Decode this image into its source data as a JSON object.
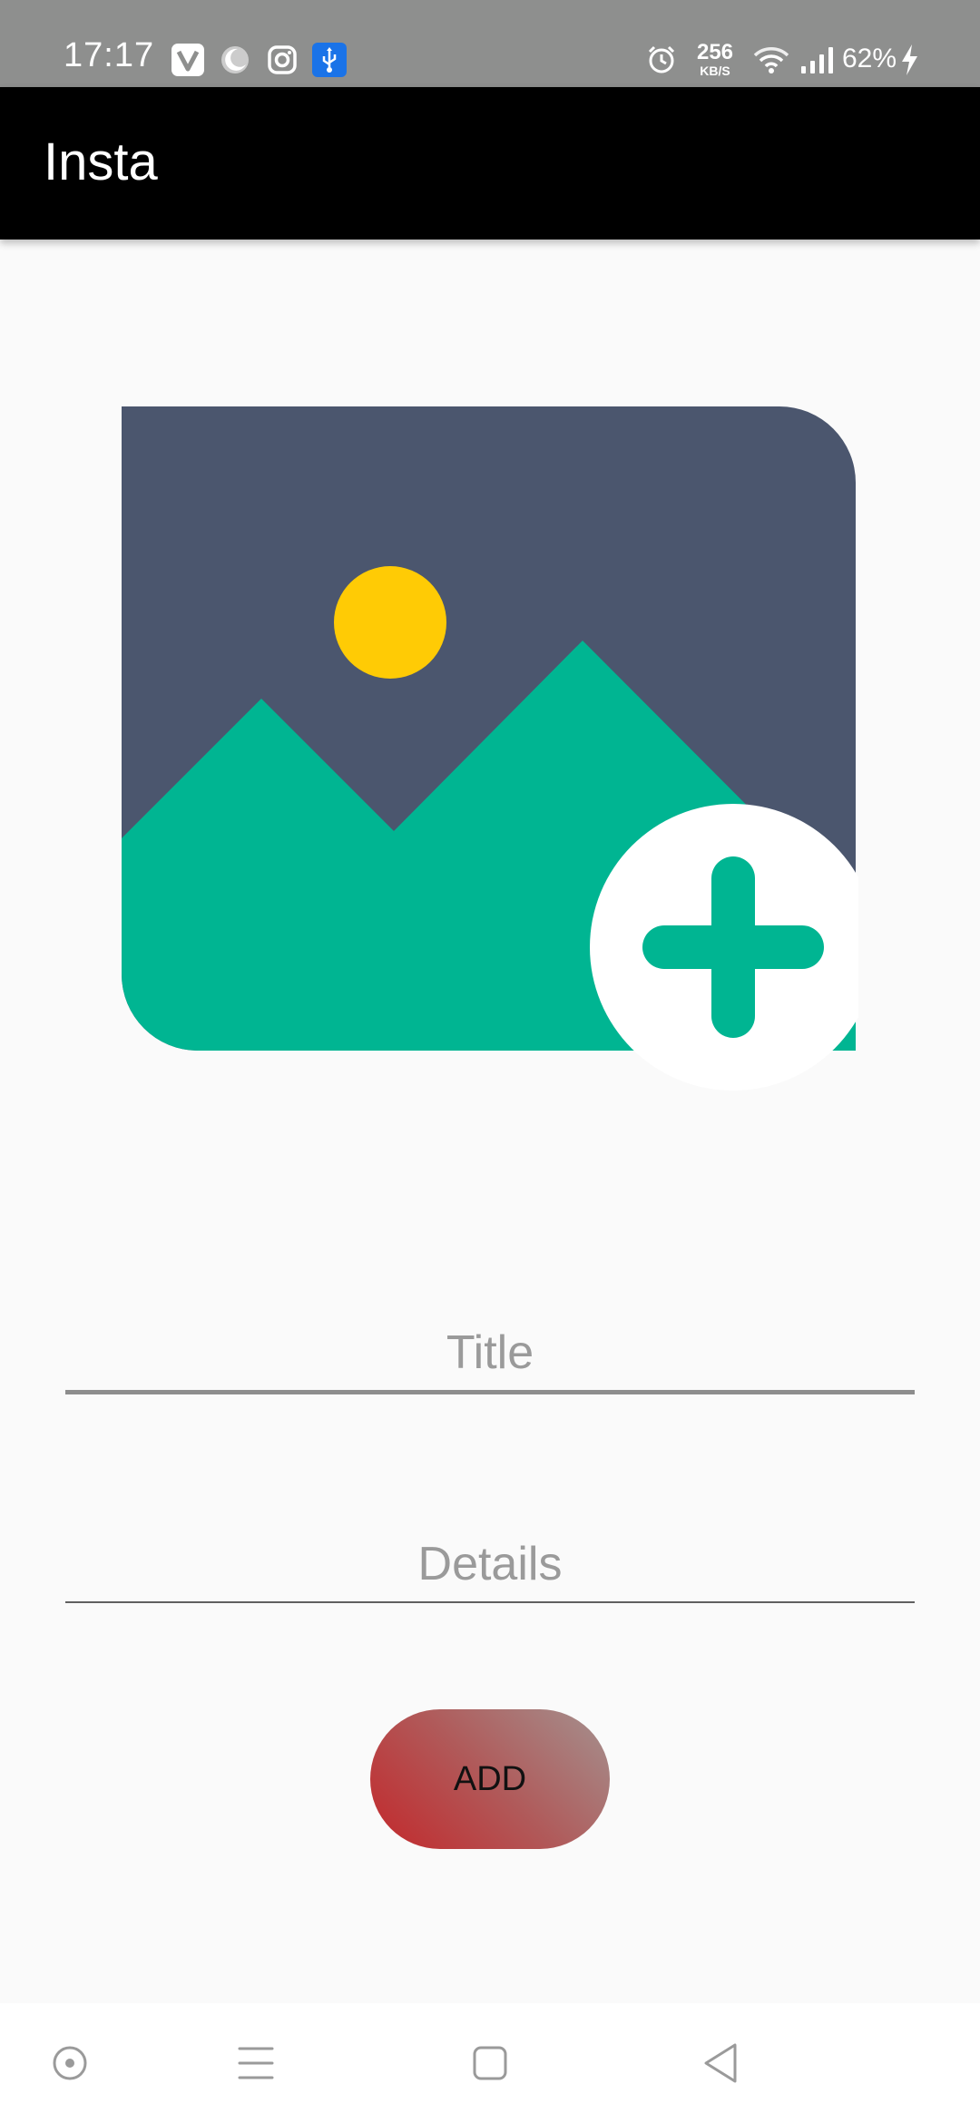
{
  "status_bar": {
    "time": "17:17",
    "net_speed_value": "256",
    "net_speed_unit": "KB/S",
    "battery": "62%",
    "icons": [
      "v-app-icon",
      "moon-icon",
      "instagram-icon",
      "usb-icon",
      "alarm-icon",
      "wifi-icon",
      "signal-icon",
      "charging-icon"
    ]
  },
  "app_bar": {
    "title": "Insta"
  },
  "form": {
    "title_placeholder": "Title",
    "title_value": "",
    "details_placeholder": "Details",
    "details_value": "",
    "add_label": "ADD"
  },
  "image_picker": {
    "icon": "add-image-icon"
  },
  "nav_bar": {
    "buttons": [
      "assistant-icon",
      "menu-icon",
      "home-icon",
      "back-icon"
    ]
  },
  "colors": {
    "status_bar": "#8e8f8e",
    "app_bar": "#000000",
    "background": "#fafafa",
    "image_sky": "#4b566e",
    "image_sun": "#ffcb05",
    "image_mountains": "#00b592",
    "button_gradient_start": "#c3282b",
    "button_gradient_end": "#a4918f"
  }
}
